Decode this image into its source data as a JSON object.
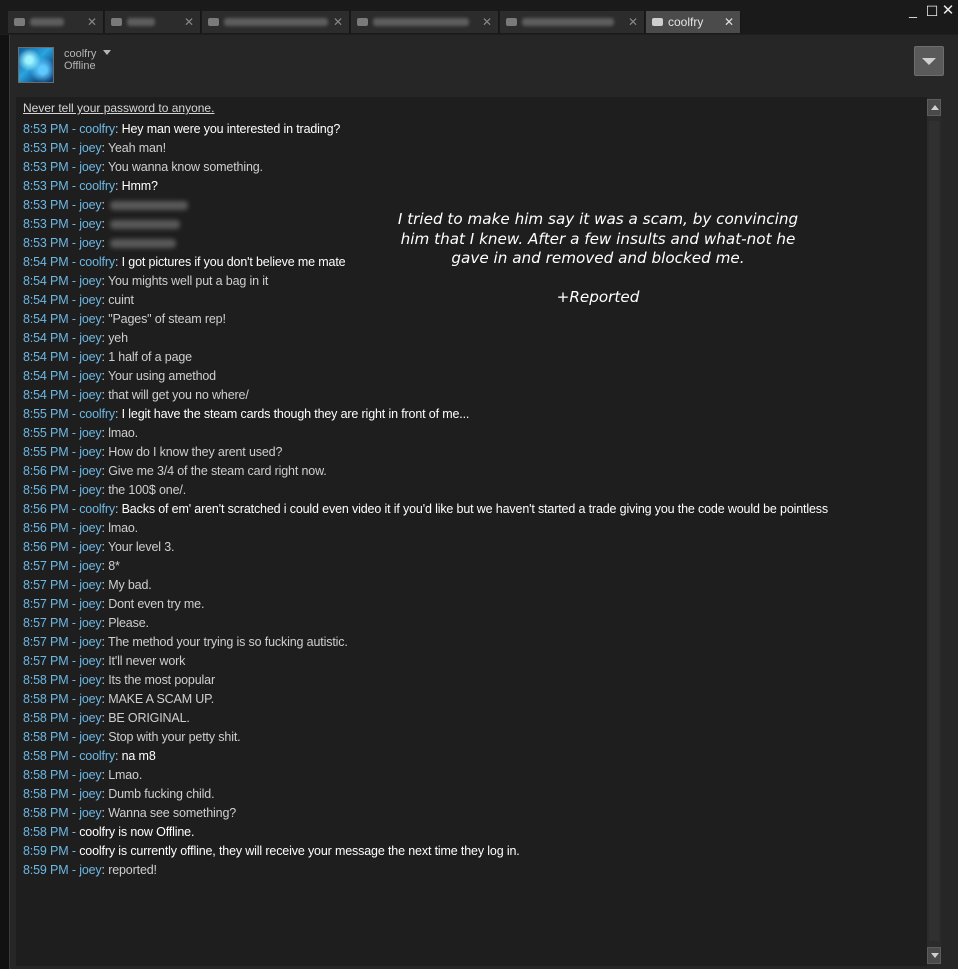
{
  "window": {
    "tabs": [
      {
        "label": "",
        "active": false
      },
      {
        "label": "",
        "active": false
      },
      {
        "label": "",
        "active": false
      },
      {
        "label": "",
        "active": false
      },
      {
        "label": "",
        "active": false
      },
      {
        "label": "coolfry",
        "active": true
      }
    ],
    "controls": {
      "minimize": "_",
      "maximize": "☐",
      "close": "✕"
    }
  },
  "friend": {
    "name": "coolfry",
    "status": "Offline",
    "avatar_icon": "avatar-image"
  },
  "chat": {
    "warning": "Never tell your password to anyone.",
    "messages": [
      {
        "time": "8:53 PM",
        "sender": "coolfry",
        "text": "Hey man were you interested in trading?",
        "self": true
      },
      {
        "time": "8:53 PM",
        "sender": "joey",
        "text": "Yeah man!",
        "self": false
      },
      {
        "time": "8:53 PM",
        "sender": "joey",
        "text": "You wanna know something.",
        "self": false
      },
      {
        "time": "8:53 PM",
        "sender": "coolfry",
        "text": "Hmm?",
        "self": true
      },
      {
        "time": "8:53 PM",
        "sender": "joey",
        "text": "",
        "self": false,
        "redacted": true
      },
      {
        "time": "8:53 PM",
        "sender": "joey",
        "text": "",
        "self": false,
        "redacted": true
      },
      {
        "time": "8:53 PM",
        "sender": "joey",
        "text": "",
        "self": false,
        "redacted": true
      },
      {
        "time": "8:54 PM",
        "sender": "coolfry",
        "text": "I got pictures if you don't believe me mate",
        "self": true
      },
      {
        "time": "8:54 PM",
        "sender": "joey",
        "text": "You mights well put a bag in it",
        "self": false
      },
      {
        "time": "8:54 PM",
        "sender": "joey",
        "text": "cuint",
        "self": false
      },
      {
        "time": "8:54 PM",
        "sender": "joey",
        "text": "\"Pages\" of steam rep!",
        "self": false
      },
      {
        "time": "8:54 PM",
        "sender": "joey",
        "text": "yeh",
        "self": false
      },
      {
        "time": "8:54 PM",
        "sender": "joey",
        "text": "1 half of a page",
        "self": false
      },
      {
        "time": "8:54 PM",
        "sender": "joey",
        "text": "Your using amethod",
        "self": false
      },
      {
        "time": "8:54 PM",
        "sender": "joey",
        "text": "that will get you no where/",
        "self": false
      },
      {
        "time": "8:55 PM",
        "sender": "coolfry",
        "text": "I legit have the steam cards though they are right in front of me...",
        "self": true
      },
      {
        "time": "8:55 PM",
        "sender": "joey",
        "text": "lmao.",
        "self": false
      },
      {
        "time": "8:55 PM",
        "sender": "joey",
        "text": "How do I know they arent used?",
        "self": false
      },
      {
        "time": "8:56 PM",
        "sender": "joey",
        "text": "Give me 3/4 of the steam card right now.",
        "self": false
      },
      {
        "time": "8:56 PM",
        "sender": "joey",
        "text": "the 100$ one/.",
        "self": false
      },
      {
        "time": "8:56 PM",
        "sender": "coolfry",
        "text": "Backs of em' aren't scratched i could even video it if you'd like but we haven't started a trade giving you the code would be pointless",
        "self": true
      },
      {
        "time": "8:56 PM",
        "sender": "joey",
        "text": "lmao.",
        "self": false
      },
      {
        "time": "8:56 PM",
        "sender": "joey",
        "text": "Your level 3.",
        "self": false
      },
      {
        "time": "8:57 PM",
        "sender": "joey",
        "text": "8*",
        "self": false
      },
      {
        "time": "8:57 PM",
        "sender": "joey",
        "text": "My bad.",
        "self": false
      },
      {
        "time": "8:57 PM",
        "sender": "joey",
        "text": "Dont even try me.",
        "self": false
      },
      {
        "time": "8:57 PM",
        "sender": "joey",
        "text": "Please.",
        "self": false
      },
      {
        "time": "8:57 PM",
        "sender": "joey",
        "text": "The method your trying is so fucking autistic.",
        "self": false
      },
      {
        "time": "8:57 PM",
        "sender": "joey",
        "text": "It'll never work",
        "self": false
      },
      {
        "time": "8:58 PM",
        "sender": "joey",
        "text": "Its the most popular",
        "self": false
      },
      {
        "time": "8:58 PM",
        "sender": "joey",
        "text": "MAKE A SCAM UP.",
        "self": false
      },
      {
        "time": "8:58 PM",
        "sender": "joey",
        "text": "BE ORIGINAL.",
        "self": false
      },
      {
        "time": "8:58 PM",
        "sender": "joey",
        "text": "Stop with your petty shit.",
        "self": false
      },
      {
        "time": "8:58 PM",
        "sender": "coolfry",
        "text": "na m8",
        "self": true
      },
      {
        "time": "8:58 PM",
        "sender": "joey",
        "text": "Lmao.",
        "self": false
      },
      {
        "time": "8:58 PM",
        "sender": "joey",
        "text": "Dumb fucking child.",
        "self": false
      },
      {
        "time": "8:58 PM",
        "sender": "joey",
        "text": "Wanna see something?",
        "self": false
      },
      {
        "time": "8:58 PM",
        "sender": "",
        "text": "coolfry is now Offline.",
        "self": true,
        "system": true
      },
      {
        "time": "8:59 PM",
        "sender": "",
        "text": "coolfry is currently offline, they will receive your message the next time they log in.",
        "self": true,
        "system": true
      },
      {
        "time": "8:59 PM",
        "sender": "joey",
        "text": "reported!",
        "self": false
      }
    ]
  },
  "annotation": {
    "lines": [
      "I tried to make him say it was a scam, by convincing",
      "him that I knew. After a few insults and what-not he",
      "gave in and removed and blocked me."
    ],
    "footer": "+Reported"
  },
  "colors": {
    "timestamp": "#6db8e4",
    "self_text": "#ffffff",
    "other_text": "#cfcfcf",
    "background": "#1e1e1e"
  }
}
